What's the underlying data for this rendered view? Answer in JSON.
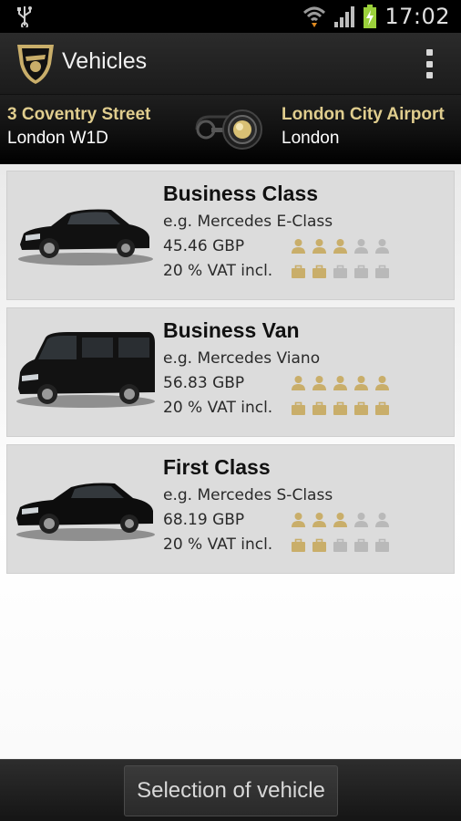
{
  "status_bar": {
    "time": "17:02",
    "icons": [
      "usb-icon",
      "wifi-icon",
      "signal-icon",
      "battery-charging-icon"
    ]
  },
  "action_bar": {
    "title": "Vehicles",
    "logo": "chauffeur-logo-icon",
    "overflow": "overflow-menu-icon"
  },
  "route": {
    "from": {
      "street": "3 Coventry Street",
      "city": "London W1D"
    },
    "to": {
      "name": "London City Airport",
      "city": "London"
    },
    "icon": "route-toggle-icon"
  },
  "colors": {
    "gold": "#e0cd8e",
    "icon_active": "#c9ae6a",
    "icon_inactive": "#b9b9b9",
    "card_bg": "#dcdcdc"
  },
  "vehicles": [
    {
      "name": "Business Class",
      "example": "e.g. Mercedes E-Class",
      "price": "45.46 GBP",
      "vat": "20 % VAT incl.",
      "passengers_active": 3,
      "passengers_total": 5,
      "luggage_active": 2,
      "luggage_total": 5,
      "image": "sedan-car-icon"
    },
    {
      "name": "Business Van",
      "example": "e.g. Mercedes Viano",
      "price": "56.83 GBP",
      "vat": "20 % VAT incl.",
      "passengers_active": 5,
      "passengers_total": 5,
      "luggage_active": 5,
      "luggage_total": 5,
      "image": "van-icon"
    },
    {
      "name": "First Class",
      "example": "e.g. Mercedes S-Class",
      "price": "68.19 GBP",
      "vat": "20 % VAT incl.",
      "passengers_active": 3,
      "passengers_total": 5,
      "luggage_active": 2,
      "luggage_total": 5,
      "image": "limousine-car-icon"
    }
  ],
  "bottom_bar": {
    "button_label": "Selection of vehicle"
  }
}
